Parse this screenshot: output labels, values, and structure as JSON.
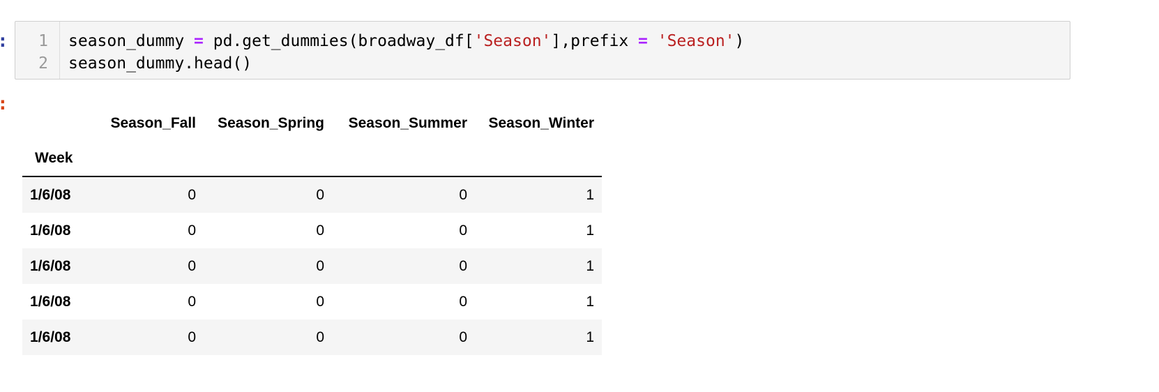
{
  "input_prompt_marker": ":",
  "output_prompt_marker": ":",
  "code": {
    "line_numbers": [
      "1",
      "2"
    ],
    "line1": {
      "t1": "season_dummy ",
      "t2": "=",
      "t3": " pd.get_dummies(broadway_df[",
      "t4": "'Season'",
      "t5": "],prefix ",
      "t6": "=",
      "t7": " ",
      "t8": "'Season'",
      "t9": ")"
    },
    "line2": "season_dummy.head()"
  },
  "dataframe": {
    "columns": [
      "Season_Fall",
      "Season_Spring",
      "Season_Summer",
      "Season_Winter"
    ],
    "index_name": "Week",
    "rows": [
      {
        "index": "1/6/08",
        "values": [
          "0",
          "0",
          "0",
          "1"
        ]
      },
      {
        "index": "1/6/08",
        "values": [
          "0",
          "0",
          "0",
          "1"
        ]
      },
      {
        "index": "1/6/08",
        "values": [
          "0",
          "0",
          "0",
          "1"
        ]
      },
      {
        "index": "1/6/08",
        "values": [
          "0",
          "0",
          "0",
          "1"
        ]
      },
      {
        "index": "1/6/08",
        "values": [
          "0",
          "0",
          "0",
          "1"
        ]
      }
    ]
  }
}
